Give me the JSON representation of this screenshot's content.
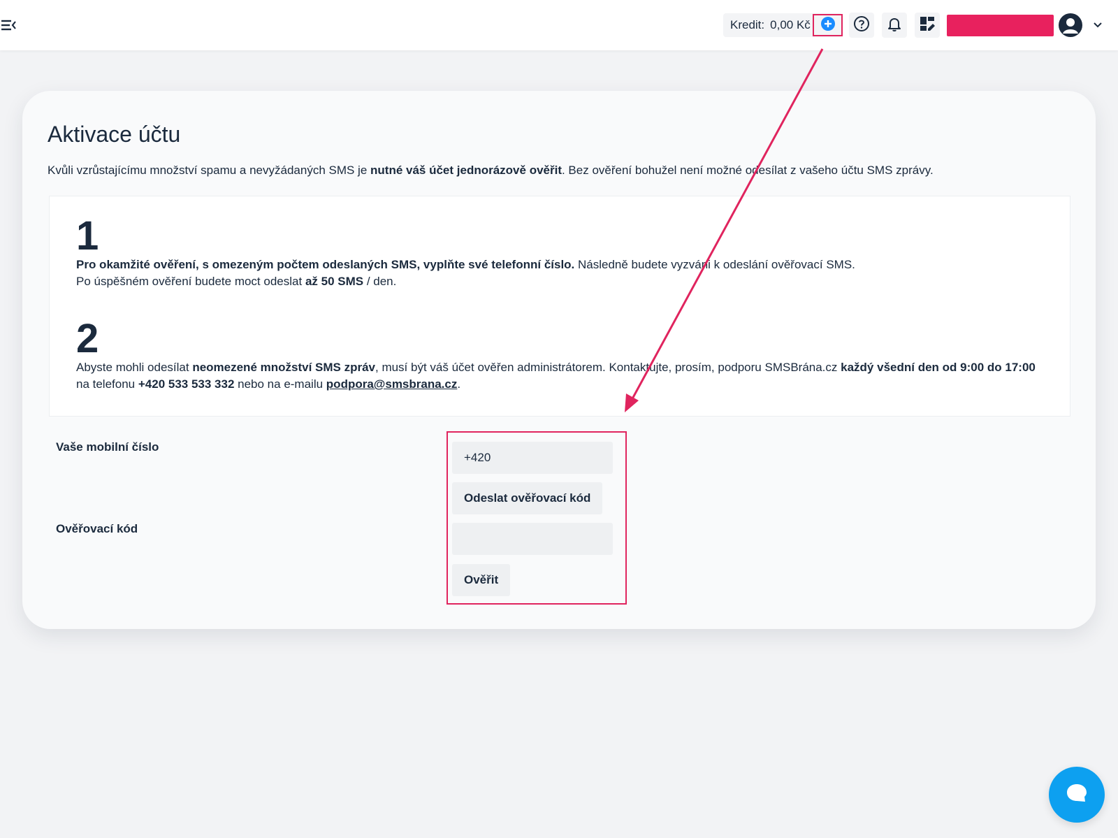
{
  "topbar": {
    "credit_label": "Kredit:",
    "credit_value": "0,00 Kč",
    "icons": [
      "menu-toggle-icon",
      "add-credit-icon",
      "help-icon",
      "bell-icon",
      "dashboard-edit-icon",
      "user-icon",
      "chevron-down-icon"
    ]
  },
  "page": {
    "title": "Aktivace účtu",
    "intro_pre": "Kvůli vzrůstajícímu množství spamu a nevyžádaných SMS je ",
    "intro_bold": "nutné váš účet jednorázově ověřit",
    "intro_post": ". Bez ověření bohužel není možné odesílat z vašeho účtu SMS zprávy."
  },
  "steps": [
    {
      "number": "1",
      "line1_bold": "Pro okamžité ověření, s omezeným počtem odeslaných SMS, vyplňte své telefonní číslo.",
      "line1_rest": " Následně budete vyzváni k odeslání ověřovací SMS.",
      "line2_pre": "Po úspěšném ověření budete moct odeslat ",
      "line2_bold": "až 50 SMS",
      "line2_post": " / den."
    },
    {
      "number": "2",
      "line1_pre": "Abyste mohli odesílat ",
      "line1_bold": "neomezené množství SMS zpráv",
      "line1_mid": ", musí být váš účet ověřen administrátorem. Kontaktujte, prosím, podporu SMSBrána.cz ",
      "line1_bold2": "každý všední den od 9:00 do 17:00",
      "line2_pre": "na telefonu ",
      "phone": "+420 533 533 332",
      "line2_mid": " nebo na e-mailu ",
      "email": "podpora@smsbrana.cz",
      "line2_post": "."
    }
  ],
  "form": {
    "phone_label": "Vaše mobilní číslo",
    "phone_value": "+420",
    "send_code_label": "Odeslat ověřovací kód",
    "code_label": "Ověřovací kód",
    "code_value": "",
    "verify_label": "Ověřit"
  },
  "colors": {
    "accent": "#e0245e",
    "text": "#1b2a3d",
    "chat": "#0da0f0",
    "info_blue": "#1a8cff"
  }
}
